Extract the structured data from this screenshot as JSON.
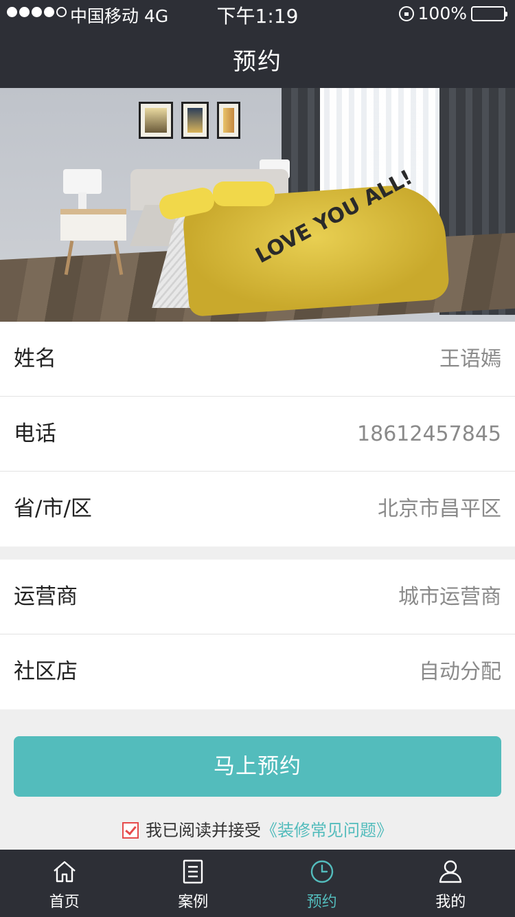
{
  "status_bar": {
    "carrier": "中国移动",
    "network": "4G",
    "time": "下午1:19",
    "battery": "100%"
  },
  "nav": {
    "title": "预约"
  },
  "form": {
    "name": {
      "label": "姓名",
      "value": "王语嫣"
    },
    "phone": {
      "label": "电话",
      "value": "18612457845"
    },
    "region": {
      "label": "省/市/区",
      "value": "北京市昌平区"
    },
    "operator": {
      "label": "运营商",
      "value": "城市运营商"
    },
    "store": {
      "label": "社区店",
      "value": "自动分配"
    }
  },
  "cta": {
    "label": "马上预约"
  },
  "agreement": {
    "text": "我已阅读并接受",
    "link": "《装修常见问题》",
    "checked": true
  },
  "tabbar": {
    "items": [
      {
        "label": "首页",
        "icon": "home-icon"
      },
      {
        "label": "案例",
        "icon": "list-icon"
      },
      {
        "label": "预约",
        "icon": "clock-icon",
        "active": true
      },
      {
        "label": "我的",
        "icon": "user-icon"
      }
    ]
  },
  "hero": {
    "duvet_text": "LOVE YOU ALL!"
  },
  "colors": {
    "accent": "#53bcbc",
    "bar_bg": "#2d2f36",
    "checkbox": "#e64b4b"
  }
}
